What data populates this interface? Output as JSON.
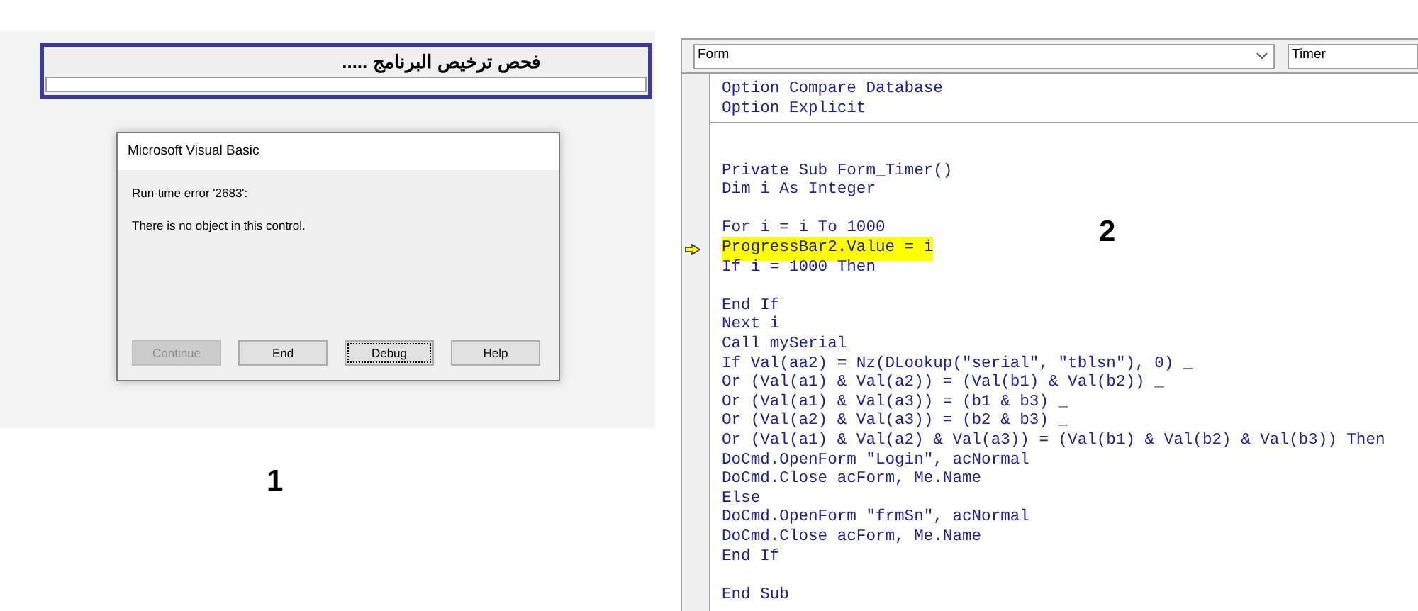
{
  "access_form": {
    "heading": "فحص ترخيص البرنامج .....",
    "progress": {
      "level": 0
    }
  },
  "dialog": {
    "title": "Microsoft Visual Basic",
    "error": "Run-time error '2683':",
    "message": "There is no object in this control.",
    "buttons": [
      {
        "label": "Continue",
        "disabled": true,
        "focused": false
      },
      {
        "label": "End",
        "disabled": false,
        "focused": false
      },
      {
        "label": "Debug",
        "disabled": false,
        "focused": true
      },
      {
        "label": "Help",
        "disabled": false,
        "focused": false
      }
    ]
  },
  "captions": [
    "1",
    "2"
  ],
  "code_window": {
    "object_box": "Form",
    "procedure_box": "Timer",
    "declarations": [
      {
        "kind": "code",
        "text": "Option Compare Database",
        "current": false
      },
      {
        "kind": "code",
        "text": "Option Explicit",
        "current": false
      }
    ],
    "procedure": [
      {
        "kind": "blank"
      },
      {
        "kind": "blank"
      },
      {
        "kind": "code",
        "text": "Private Sub Form_Timer()",
        "current": false
      },
      {
        "kind": "code",
        "text": "Dim i As Integer",
        "current": false
      },
      {
        "kind": "blank"
      },
      {
        "kind": "code",
        "text": "For i = i To 1000",
        "current": false
      },
      {
        "kind": "code",
        "text": "ProgressBar2.Value = i",
        "current": true
      },
      {
        "kind": "code",
        "text": "If i = 1000 Then",
        "current": false
      },
      {
        "kind": "blank"
      },
      {
        "kind": "code",
        "text": "End If",
        "current": false
      },
      {
        "kind": "code",
        "text": "Next i",
        "current": false
      },
      {
        "kind": "code",
        "text": "Call mySerial",
        "current": false
      },
      {
        "kind": "code",
        "text": "If Val(aa2) = Nz(DLookup(\"serial\", \"tblsn\"), 0) _",
        "current": false
      },
      {
        "kind": "code",
        "text": "Or (Val(a1) & Val(a2)) = (Val(b1) & Val(b2)) _",
        "current": false
      },
      {
        "kind": "code",
        "text": "Or (Val(a1) & Val(a3)) = (b1 & b3) _",
        "current": false
      },
      {
        "kind": "code",
        "text": "Or (Val(a2) & Val(a3)) = (b2 & b3) _",
        "current": false
      },
      {
        "kind": "code",
        "text": "Or (Val(a1) & Val(a2) & Val(a3)) = (Val(b1) & Val(b2) & Val(b3)) Then",
        "current": false
      },
      {
        "kind": "code",
        "text": "DoCmd.OpenForm \"Login\", acNormal",
        "current": false
      },
      {
        "kind": "code",
        "text": "DoCmd.Close acForm, Me.Name",
        "current": false
      },
      {
        "kind": "code",
        "text": "Else",
        "current": false
      },
      {
        "kind": "code",
        "text": "DoCmd.OpenForm \"frmSn\", acNormal",
        "current": false
      },
      {
        "kind": "code",
        "text": "DoCmd.Close acForm, Me.Name",
        "current": false
      },
      {
        "kind": "code",
        "text": "End If",
        "current": false
      },
      {
        "kind": "blank"
      },
      {
        "kind": "code",
        "text": "End Sub",
        "current": false
      }
    ]
  }
}
